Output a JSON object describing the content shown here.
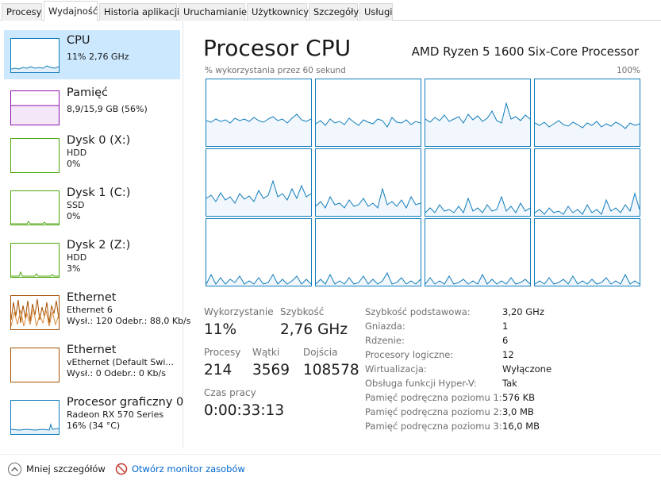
{
  "tabs": [
    {
      "label": "Procesy",
      "active": false
    },
    {
      "label": "Wydajność",
      "active": true
    },
    {
      "label": "Historia aplikacji",
      "active": false
    },
    {
      "label": "Uruchamianie",
      "active": false
    },
    {
      "label": "Użytkownicy",
      "active": false
    },
    {
      "label": "Szczegóły",
      "active": false
    },
    {
      "label": "Usługi",
      "active": false
    }
  ],
  "sidebar": {
    "items": [
      {
        "title": "CPU",
        "lines": [
          "11%  2,76 GHz"
        ],
        "color": "#117dbb",
        "selected": true,
        "icon": "cpu-graph-icon"
      },
      {
        "title": "Pamięć",
        "lines": [
          "8,9/15,9 GB (56%)"
        ],
        "color": "#8b12ae",
        "selected": false,
        "icon": "memory-graph-icon"
      },
      {
        "title": "Dysk 0 (X:)",
        "lines": [
          "HDD",
          "0%"
        ],
        "color": "#4da60c",
        "selected": false,
        "icon": "disk-graph-icon"
      },
      {
        "title": "Dysk 1 (C:)",
        "lines": [
          "SSD",
          "0%"
        ],
        "color": "#4da60c",
        "selected": false,
        "icon": "disk-graph-icon"
      },
      {
        "title": "Dysk 2 (Z:)",
        "lines": [
          "HDD",
          "3%"
        ],
        "color": "#4da60c",
        "selected": false,
        "icon": "disk-graph-icon"
      },
      {
        "title": "Ethernet",
        "lines": [
          "Ethernet 6",
          "Wysł.: 120  Odebr.: 88,0 Kb/s"
        ],
        "color": "#a74f01",
        "selected": false,
        "icon": "network-graph-icon"
      },
      {
        "title": "Ethernet",
        "lines": [
          "vEthernet (Default Swi...",
          "Wysł.: 0  Odebr.: 0 Kb/s"
        ],
        "color": "#a74f01",
        "selected": false,
        "icon": "network-graph-icon"
      },
      {
        "title": "Procesor graficzny 0",
        "lines": [
          "Radeon RX 570 Series",
          "16%  (34 °C)"
        ],
        "color": "#117dbb",
        "selected": false,
        "icon": "gpu-graph-icon"
      }
    ]
  },
  "header": {
    "title": "Procesor CPU",
    "processor": "AMD Ryzen 5 1600 Six-Core Processor",
    "util_label": "% wykorzystania przez 60 sekund",
    "util_max": "100%"
  },
  "stats": {
    "utilization_label": "Wykorzystanie",
    "utilization_value": "11%",
    "speed_label": "Szybkość",
    "speed_value": "2,76 GHz",
    "processes_label": "Procesy",
    "processes_value": "214",
    "threads_label": "Wątki",
    "threads_value": "3569",
    "handles_label": "Dojścia",
    "handles_value": "108578",
    "uptime_label": "Czas pracy",
    "uptime_value": "0:00:33:13"
  },
  "specs": [
    {
      "label": "Szybkość podstawowa:",
      "value": "3,20 GHz"
    },
    {
      "label": "Gniazda:",
      "value": "1"
    },
    {
      "label": "Rdzenie:",
      "value": "6"
    },
    {
      "label": "Procesory logiczne:",
      "value": "12"
    },
    {
      "label": "Wirtualizacja:",
      "value": "Wyłączone"
    },
    {
      "label": "Obsługa funkcji Hyper-V:",
      "value": "Tak"
    },
    {
      "label": "Pamięć podręczna poziomu 1:",
      "value": "576 KB"
    },
    {
      "label": "Pamięć podręczna poziomu 2:",
      "value": "3,0 MB"
    },
    {
      "label": "Pamięć podręczna poziomu 3:",
      "value": "16,0 MB"
    }
  ],
  "footer": {
    "less_details": "Mniej szczegółów",
    "resource_monitor": "Otwórz monitor zasobów"
  },
  "colors": {
    "cpu": "#117dbb",
    "selected_bg": "#cce8ff",
    "link": "#0066cc"
  }
}
